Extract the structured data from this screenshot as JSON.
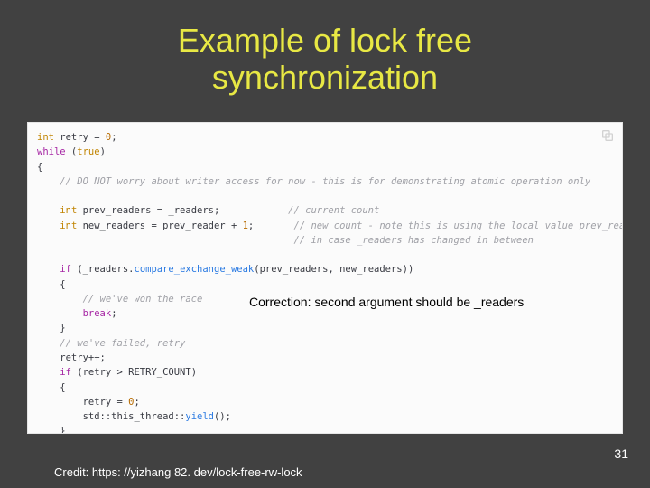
{
  "title": "Example of lock free\nsynchronization",
  "code": {
    "lines": [
      [
        [
          "tok-type",
          "int"
        ],
        [
          "tok-ident",
          " retry "
        ],
        [
          "tok-punc",
          "= "
        ],
        [
          "tok-num",
          "0"
        ],
        [
          "tok-punc",
          ";"
        ]
      ],
      [
        [
          "tok-kw",
          "while"
        ],
        [
          "tok-punc",
          " ("
        ],
        [
          "tok-type",
          "true"
        ],
        [
          "tok-punc",
          ")"
        ]
      ],
      [
        [
          "tok-punc",
          "{"
        ]
      ],
      [
        [
          "tok-ident",
          "    "
        ],
        [
          "tok-cmt",
          "// DO NOT worry about writer access for now - this is for demonstrating atomic operation only"
        ]
      ],
      [
        [
          "tok-ident",
          ""
        ]
      ],
      [
        [
          "tok-ident",
          "    "
        ],
        [
          "tok-type",
          "int"
        ],
        [
          "tok-ident",
          " prev_readers = _readers;            "
        ],
        [
          "tok-cmt",
          "// current count"
        ]
      ],
      [
        [
          "tok-ident",
          "    "
        ],
        [
          "tok-type",
          "int"
        ],
        [
          "tok-ident",
          " new_readers = prev_reader + "
        ],
        [
          "tok-num",
          "1"
        ],
        [
          "tok-punc",
          ";       "
        ],
        [
          "tok-cmt",
          "// new count - note this is using the local value prev_readers"
        ]
      ],
      [
        [
          "tok-ident",
          "                                             "
        ],
        [
          "tok-cmt",
          "// in case _readers has changed in between"
        ]
      ],
      [
        [
          "tok-ident",
          ""
        ]
      ],
      [
        [
          "tok-ident",
          "    "
        ],
        [
          "tok-kw",
          "if"
        ],
        [
          "tok-punc",
          " (_readers."
        ],
        [
          "tok-call",
          "compare_exchange_weak"
        ],
        [
          "tok-punc",
          "(prev_readers, new_readers))"
        ]
      ],
      [
        [
          "tok-ident",
          "    "
        ],
        [
          "tok-punc",
          "{"
        ]
      ],
      [
        [
          "tok-ident",
          "        "
        ],
        [
          "tok-cmt",
          "// we've won the race"
        ]
      ],
      [
        [
          "tok-ident",
          "        "
        ],
        [
          "tok-kw",
          "break"
        ],
        [
          "tok-punc",
          ";"
        ]
      ],
      [
        [
          "tok-ident",
          "    "
        ],
        [
          "tok-punc",
          "}"
        ]
      ],
      [
        [
          "tok-ident",
          "    "
        ],
        [
          "tok-cmt",
          "// we've failed, retry"
        ]
      ],
      [
        [
          "tok-ident",
          "    retry++;"
        ]
      ],
      [
        [
          "tok-ident",
          "    "
        ],
        [
          "tok-kw",
          "if"
        ],
        [
          "tok-punc",
          " (retry > RETRY_COUNT)"
        ]
      ],
      [
        [
          "tok-ident",
          "    "
        ],
        [
          "tok-punc",
          "{"
        ]
      ],
      [
        [
          "tok-ident",
          "        retry = "
        ],
        [
          "tok-num",
          "0"
        ],
        [
          "tok-punc",
          ";"
        ]
      ],
      [
        [
          "tok-ident",
          "        std::this_thread::"
        ],
        [
          "tok-call",
          "yield"
        ],
        [
          "tok-punc",
          "();"
        ]
      ],
      [
        [
          "tok-ident",
          "    "
        ],
        [
          "tok-punc",
          "}"
        ]
      ],
      [
        [
          "tok-punc",
          "}"
        ]
      ]
    ]
  },
  "correction": "Correction: second argument should be _readers",
  "credit": "Credit: https: //yizhang 82. dev/lock-free-rw-lock",
  "page_number": "31",
  "icons": {
    "copy": "copy-icon"
  }
}
